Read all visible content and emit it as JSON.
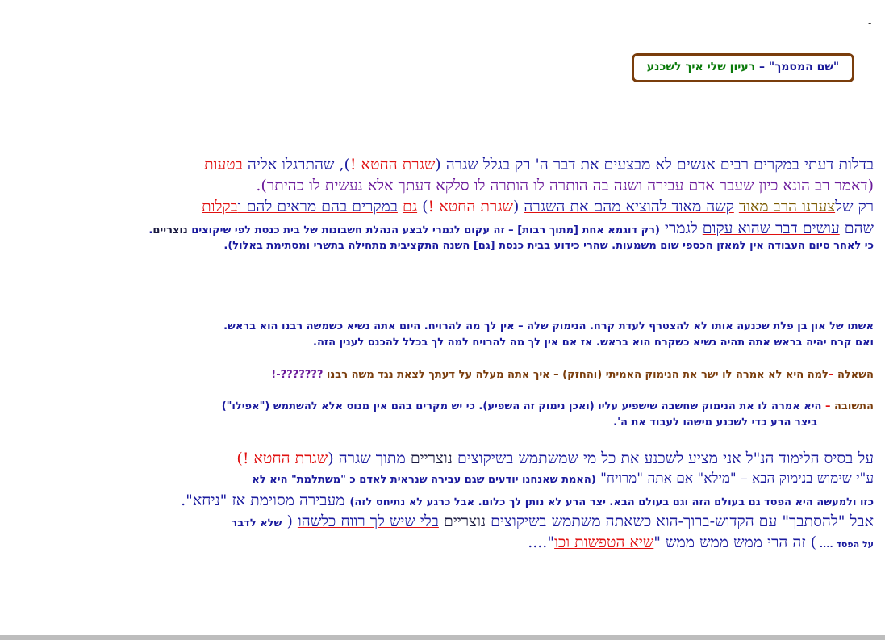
{
  "top_mark": "-",
  "title_box": {
    "doc_name": "\"שם המסמך\"",
    "dash": " – ",
    "subtitle": "רעיון שלי איך לשכנע"
  },
  "para1": {
    "l1_a": "בדלות דעתי במקרים רבים אנשים לא מבצעים את דבר ה' רק בגלל שגרה (",
    "l1_b": "שגרת החטא !",
    "l1_c": "), שהתרגלו אליה ",
    "l1_d": "בטעות",
    "l2": "(דאמר רב הונא כיון שעבר אדם עבירה ושנה בה הותרה לו הותרה לו סלקא דעתך אלא נעשית לו כהיתר).",
    "l3_a": "רק של",
    "l3_b": "צערנו הרב מאוד",
    "l3_c": " ",
    "l3_d": "קשה מאוד להוציא מהם את השגרה",
    "l3_e": " (",
    "l3_f": "שגרת החטא !",
    "l3_g": ") ",
    "l3_h": "גם",
    "l3_i": " ",
    "l3_j": "במקרים בהם מראים להם ו",
    "l3_k": "בקלות",
    "l4_a": "שהם ",
    "l4_b": "עושים דבר שהוא עקום",
    "l4_c": " לגמרי ",
    "l4_d": "(רק דוגמא אחת [מתוך רבות] – זה עקום לגמרי לבצע הנהלת חשבונות של בית כנסת לפי שיקוצים ",
    "l4_e": "נוצריים",
    "l4_f": ".",
    "l5": "כי לאחר סיום העבודה אין למאזן הכספי שום משמעות. שהרי כידוע בבית כנסת [גם] השנה התקציבית מתחילה בתשרי ומסתימת באלול)."
  },
  "story": {
    "s1": "אשתו של און בן פלת שכנעה אותו לא להצטרף לעדת קרח. הנימוק שלה – אין לך מה להרויח. היום אתה נשיא כשמשה רבנו הוא בראש.",
    "s2": "ואם קרח יהיה בראש אתה תהיה נשיא כשקרח הוא בראש. אז אם אין לך מה להרויח למה לך בכלל להכנס לענין הזה.",
    "q_label": "השאלה",
    "q_dash": " –",
    "q_text": "למה היא לא אמרה לו ישר את הנימוק האמיתי (והחזק) – איך אתה מעלה על דעתך לצאת נגד משה רבנו ",
    "q_marks": "???????-!",
    "a_label": "התשובה",
    "a_dash": " – ",
    "a_text1": "היא אמרה לו את הנימוק שחשבה שישפיע עליו (ואכן נימוק זה השפיע). כי יש מקרים בהם אין מנוס אלא להשתמש (\"אפילו\")",
    "a_text2": "ביצר הרע כדי לשכנע מישהו לעבוד את ה'."
  },
  "conclusion": {
    "c1_a": "על בסיס הלימוד הנ\"ל אני מציע לשכנע את כל מי שמשתמש בשיקוצים ",
    "c1_b": "נוצריים",
    "c1_c": " מתוך שגרה (",
    "c1_d": "שגרת החטא",
    "c1_e": " !)",
    "c2_a": "ע\"י שימוש בנימוק הבא – \"מילא\" אם אתה \"מרויח\" ",
    "c2_b": "(האמת שאנחנו יודעים שגם עבירה שנראית לאדם כ \"משתלמת\" היא לא",
    "c3_a": "כזו ולמעשה היא הפסד גם בעולם הזה וגם בעולם הבא. יצר הרע לא נותן לך כלום. אבל כרגע לא נתיחס לזה)",
    "c3_b": " מעבירה מסוימת אז \"ניחא\".",
    "c4_a": "אבל \"להסתבך\" עם הקדוש-ברוך-הוא כשאתה משתמש בשיקוצים ",
    "c4_b": "נוצריים",
    "c4_c": " ",
    "c4_d": "בלי שיש לך רווח כלשהו",
    "c4_e": " ( ",
    "c4_f": "שלא לדבר",
    "c5_a": "על הפסד .... ",
    "c5_b": ") זה הרי ממש ממש ממש \"",
    "c5_c": "שיא הטפשות וכו",
    "c5_d": "\"...."
  }
}
